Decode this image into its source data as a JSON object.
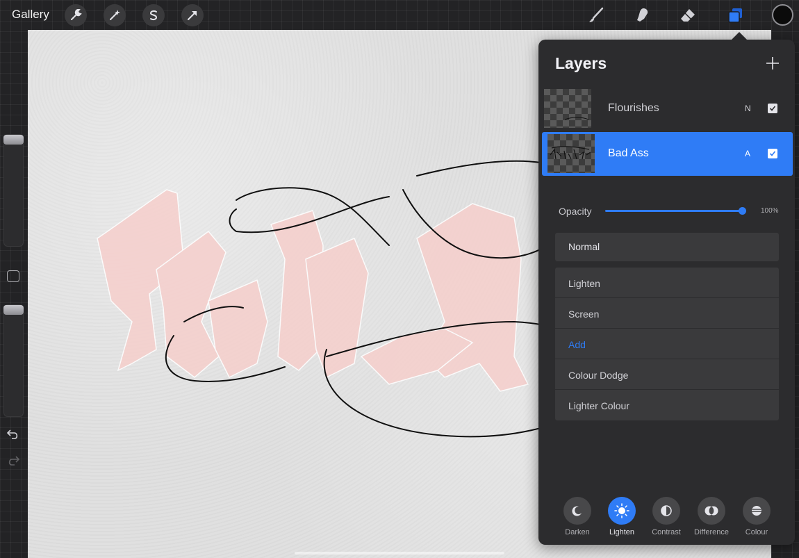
{
  "app": {
    "gallery_label": "Gallery",
    "color_swatch": "#0b0b0b",
    "accent": "#2f7cf6"
  },
  "toolbar_left": [
    {
      "name": "actions",
      "icon": "wrench-icon"
    },
    {
      "name": "adjustments",
      "icon": "magic-wand-icon"
    },
    {
      "name": "selection",
      "icon": "selection-s-icon"
    },
    {
      "name": "transform",
      "icon": "arrow-cursor-icon"
    }
  ],
  "toolbar_right": [
    {
      "name": "brush",
      "icon": "brush-icon"
    },
    {
      "name": "smudge",
      "icon": "smudge-finger-icon"
    },
    {
      "name": "eraser",
      "icon": "eraser-icon"
    },
    {
      "name": "layers",
      "icon": "layers-icon",
      "active": true
    }
  ],
  "sidebar": {
    "brush_size_level": 1.0,
    "brush_opacity_level": 1.0,
    "undo_icon": "undo-icon",
    "redo_icon": "redo-icon"
  },
  "layers": {
    "title": "Layers",
    "items": [
      {
        "name": "Flourishes",
        "mode": "N",
        "visible": true,
        "selected": false
      },
      {
        "name": "Bad Ass",
        "mode": "A",
        "visible": true,
        "selected": true
      }
    ],
    "opacity_label": "Opacity",
    "opacity_value": "100%",
    "opacity_level": 1.0,
    "current_blend": "Normal",
    "blend_options": [
      {
        "label": "Lighten",
        "active": false
      },
      {
        "label": "Screen",
        "active": false
      },
      {
        "label": "Add",
        "active": true
      },
      {
        "label": "Colour Dodge",
        "active": false
      },
      {
        "label": "Lighter Colour",
        "active": false
      }
    ],
    "categories": [
      {
        "label": "Darken",
        "icon": "moon-icon",
        "active": false
      },
      {
        "label": "Lighten",
        "icon": "sun-icon",
        "active": true
      },
      {
        "label": "Contrast",
        "icon": "half-circle-icon",
        "active": false
      },
      {
        "label": "Difference",
        "icon": "difference-icon",
        "active": false
      },
      {
        "label": "Colour",
        "icon": "colour-icon",
        "active": false
      }
    ]
  }
}
